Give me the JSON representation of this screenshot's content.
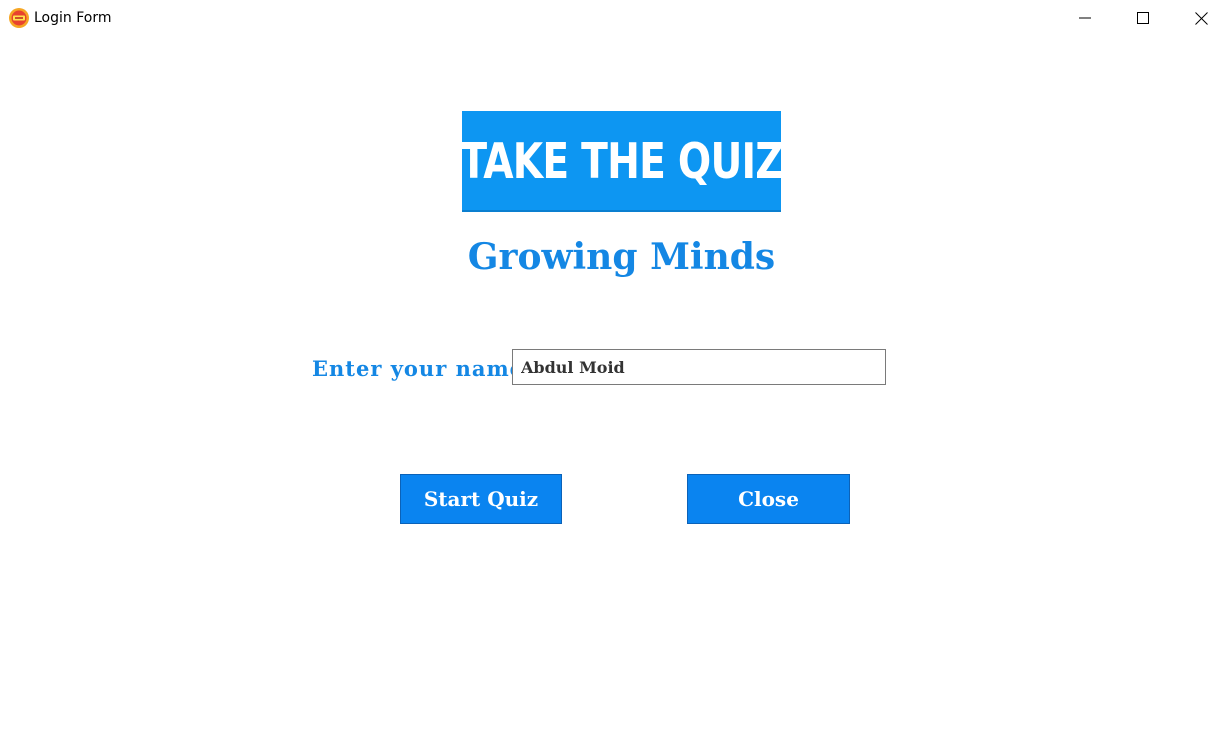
{
  "window": {
    "title": "Login Form",
    "app_icon": "quiz-app-icon",
    "controls": {
      "minimize_icon": "minimize-icon",
      "maximize_icon": "maximize-icon",
      "close_icon": "close-icon"
    }
  },
  "banner": {
    "text": "TAKE THE QUIZ",
    "background_color": "#0d96f2"
  },
  "heading": "Growing Minds",
  "form": {
    "name_label": "Enter your name :",
    "name_value": "Abdul Moid"
  },
  "buttons": {
    "start_label": "Start Quiz",
    "close_label": "Close"
  },
  "colors": {
    "accent": "#1487e4",
    "button": "#0a84f0"
  }
}
